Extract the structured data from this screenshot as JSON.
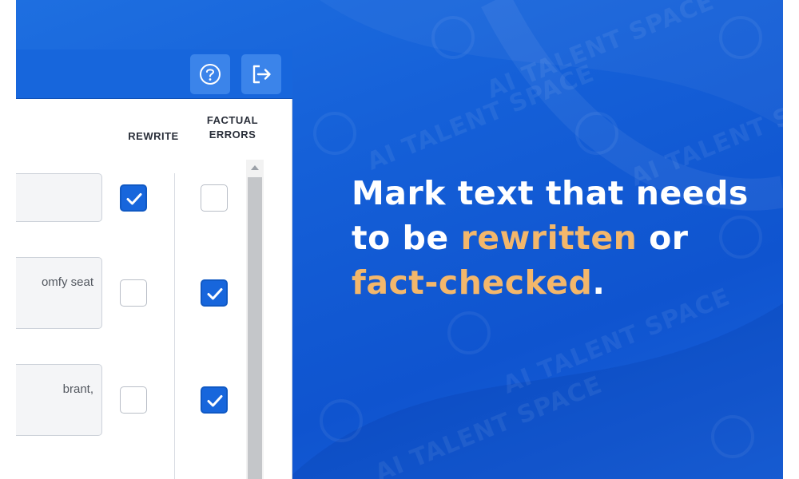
{
  "watermark": {
    "text": "AI TALENT SPACE"
  },
  "header": {
    "help_icon": "question-circle-icon",
    "logout_icon": "logout-arrow-icon"
  },
  "columns": {
    "rewrite": "REWRITE",
    "factual_line1": "FACTUAL",
    "factual_line2": "ERRORS"
  },
  "rows": [
    {
      "text": "",
      "rewrite": true,
      "factual": false
    },
    {
      "text": "omfy seat",
      "rewrite": false,
      "factual": true
    },
    {
      "text": "brant,",
      "rewrite": false,
      "factual": true
    }
  ],
  "headline": {
    "part1": "Mark text that needs to be ",
    "highlight1": "rewritten",
    "part2": " or ",
    "highlight2": "fact-checked",
    "part3": "."
  },
  "colors": {
    "background_blue": "#1560d8",
    "header_blue": "#1766dc",
    "header_button": "#3b84ea",
    "highlight_orange": "#f3b76b",
    "checkbox_checked": "#1766dc"
  }
}
